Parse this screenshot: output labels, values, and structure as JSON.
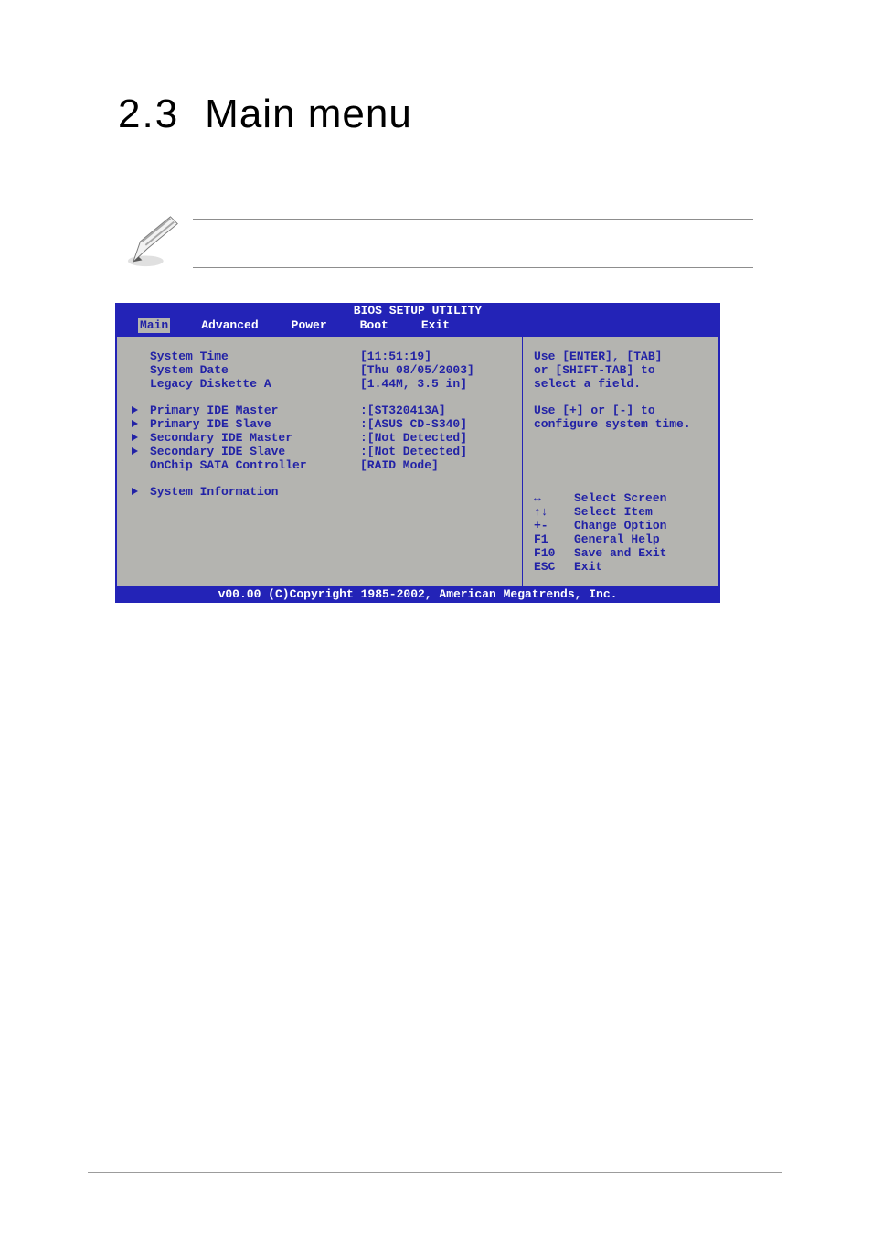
{
  "heading": {
    "num": "2.3",
    "title": "Main menu"
  },
  "bios": {
    "title": "BIOS SETUP UTILITY",
    "tabs": {
      "main": "Main",
      "advanced": "Advanced",
      "power": "Power",
      "boot": "Boot",
      "exit": "Exit"
    },
    "items": {
      "system_time": {
        "label": "System Time",
        "value": "[11:51:19]"
      },
      "system_date": {
        "label": "System Date",
        "value": "[Thu 08/05/2003]"
      },
      "legacy_diskette_a": {
        "label": "Legacy Diskette A",
        "value": "[1.44M, 3.5 in]"
      },
      "primary_ide_master": {
        "label": "Primary IDE Master",
        "value": ":[ST320413A]"
      },
      "primary_ide_slave": {
        "label": "Primary IDE Slave",
        "value": ":[ASUS CD-S340]"
      },
      "secondary_ide_master": {
        "label": "Secondary IDE Master",
        "value": ":[Not Detected]"
      },
      "secondary_ide_slave": {
        "label": "Secondary IDE Slave",
        "value": ":[Not Detected]"
      },
      "onchip_sata": {
        "label": "OnChip SATA Controller",
        "value": "[RAID Mode]"
      },
      "system_information": {
        "label": "System Information"
      }
    },
    "help": {
      "line1": "Use [ENTER], [TAB]",
      "line2": "or [SHIFT-TAB] to",
      "line3": "select a field.",
      "line4": "Use [+] or [-] to",
      "line5": "configure system time."
    },
    "nav": {
      "r1": {
        "key": "↔",
        "label": "Select Screen"
      },
      "r2": {
        "key": "↑↓",
        "label": "Select Item"
      },
      "r3": {
        "key": "+-",
        "label": "Change Option"
      },
      "r4": {
        "key": "F1",
        "label": "General Help"
      },
      "r5": {
        "key": "F10",
        "label": "Save and Exit"
      },
      "r6": {
        "key": "ESC",
        "label": "Exit"
      }
    },
    "footer": "v00.00 (C)Copyright 1985-2002, American Megatrends, Inc."
  }
}
